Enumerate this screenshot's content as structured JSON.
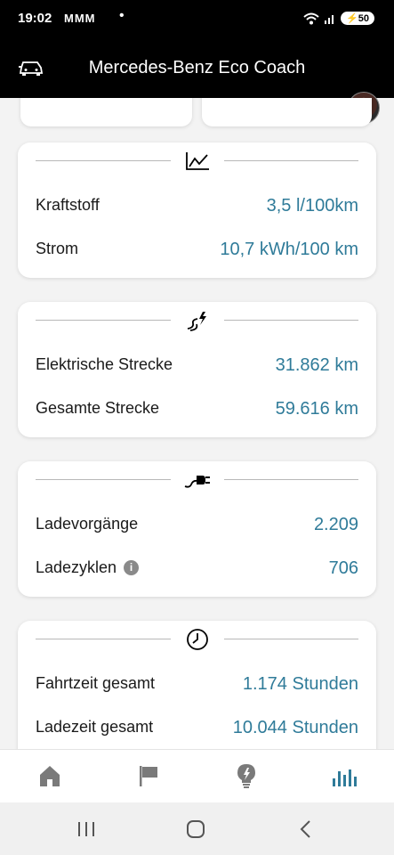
{
  "status_bar": {
    "time": "19:02",
    "notifications": "MMM",
    "dot": "•",
    "battery": "50"
  },
  "app_bar": {
    "title": "Mercedes-Benz Eco Coach"
  },
  "cards": {
    "consumption": {
      "icon": "line-chart-icon",
      "rows": [
        {
          "label": "Kraftstoff",
          "value": "3,5 l/100km"
        },
        {
          "label": "Strom",
          "value": "10,7 kWh/100 km"
        }
      ]
    },
    "distance": {
      "icon": "electric-road-icon",
      "rows": [
        {
          "label": "Elektrische Strecke",
          "value": "31.862 km"
        },
        {
          "label": "Gesamte Strecke",
          "value": "59.616 km"
        }
      ]
    },
    "charging": {
      "icon": "plug-icon",
      "rows": [
        {
          "label": "Ladevorgänge",
          "value": "2.209"
        },
        {
          "label": "Ladezyklen",
          "value": "706"
        }
      ]
    },
    "time": {
      "icon": "clock-icon",
      "rows": [
        {
          "label": "Fahrtzeit gesamt",
          "value": "1.174 Stunden"
        },
        {
          "label": "Ladezeit gesamt",
          "value": "10.044 Stunden"
        }
      ]
    }
  },
  "bottom_nav": {
    "items": [
      "home-icon",
      "flag-icon",
      "lightbulb-icon",
      "statistics-icon"
    ],
    "active": "statistics-icon"
  },
  "colors": {
    "accent": "#2f7b99",
    "header": "#000000",
    "background": "#f3f3f3"
  }
}
